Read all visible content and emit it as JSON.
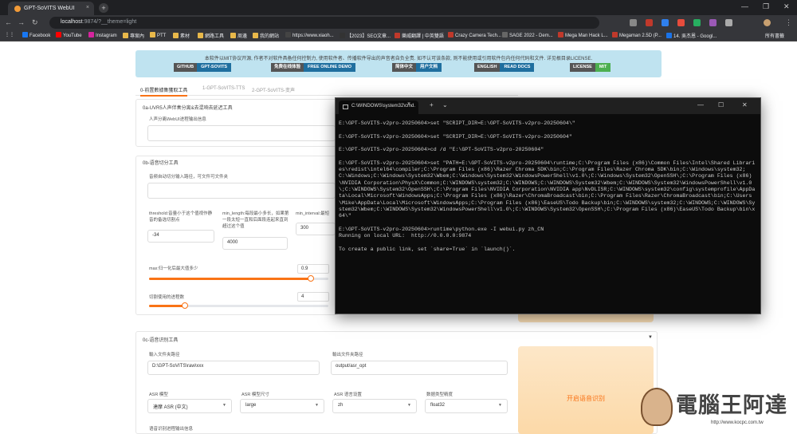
{
  "browser": {
    "tab_title": "GPT-SoVITS WebUI",
    "tab_close": "×",
    "new_tab": "+",
    "url_host": "localhost",
    "url_rest": ":9874/?__theme=light",
    "window_controls": [
      "—",
      "❐",
      "✕"
    ],
    "bookmarks": [
      "Facebook",
      "YouTube",
      "Instagram",
      "專案內",
      "PTT",
      "素材",
      "網路工具",
      "周邊",
      "我的網站",
      "https://www.xiaoh...",
      "【2023】SEO文章...",
      "樂威翻譯 | 中英雙語",
      "Crazy Camera Tech...",
      "SAGE 2022 - Dem...",
      "Mega Man Hack L...",
      "Megaman 2.5D (P...",
      "14. 吳杰恩 - Googl..."
    ],
    "bookmarks_right": "所有書籤",
    "colors": {
      "chrome_dark": "#35363a",
      "accent": "#f97316"
    }
  },
  "banner": {
    "text": "本软件以MIT协议开源, 作者不对软件具备任何控制力, 使用软件者、传播软件导出的声音者自负全责. 如不认可该条款, 则不能使用或引用软件包内任何代码和文件. 详见根目录LICENSE.",
    "badges": [
      {
        "left": "GITHUB",
        "right": "GPT-SOVITS"
      },
      {
        "left": "免费在线体验",
        "right": "FREE ONLINE DEMO"
      },
      {
        "left": "简体中文",
        "right": "用户文档"
      },
      {
        "left": "ENGLISH",
        "right": "READ DOCS"
      },
      {
        "left": "LICENSE",
        "right": "MIT"
      }
    ]
  },
  "tabs": [
    "0-前置數據集獲取工具",
    "1-GPT-SoVITS-TTS",
    "2-GPT-SoVITS-变声"
  ],
  "uvr": {
    "title": "0a-UVR5人声伴奏分离&去混响去延迟工具",
    "field_label": "人声分离WebUI进程输出信息"
  },
  "slicer": {
    "title": "0b-语音切分工具",
    "input_label": "音频自动切分输入路径，可文件可文件夹",
    "threshold_label": "threshold:音量小于这个值视作静音的备选切割点",
    "threshold_value": "-34",
    "minlen_label": "min_length:每段最小多长，如果第一段太短一直和后面段连起来直到超过这个值",
    "minlen_value": "4000",
    "mininterval_label": "min_interval:最短",
    "mininterval_value": "300",
    "max_label": "max:归一化后最大值多少",
    "max_value": "0.9",
    "max_fraction": 0.9,
    "procs_label": "切割使用的进程数",
    "procs_value": "4",
    "procs_fraction": 0.2
  },
  "asr": {
    "title": "0c-语音识别工具",
    "collapse": "▼",
    "input_label": "輸入文件夹路径",
    "input_value": "D:\\GPT-SoVITS\\raw\\xxx",
    "output_label": "輸出文件夹路径",
    "output_value": "output/asr_opt",
    "model_label": "ASR 模型",
    "model_value": "達摩 ASR (中文)",
    "size_label": "ASR 模型尺寸",
    "size_value": "large",
    "lang_label": "ASR 语言设置",
    "lang_value": "zh",
    "precision_label": "数据类型精度",
    "precision_value": "float32",
    "button": "开启语音识别",
    "log_label": "语音识别进程输出信息"
  },
  "terminal": {
    "tab_title": "C:\\WINDOWS\\system32\\cmd.",
    "controls": [
      "×",
      "+",
      "⌄",
      "—",
      "☐",
      "✕"
    ],
    "lines": [
      "E:\\GPT-SoVITS-v2pro-20250604>set \"SCRIPT_DIR=E:\\GPT-SoVITS-v2pro-20250604\\\"",
      "",
      "E:\\GPT-SoVITS-v2pro-20250604>set \"SCRIPT_DIR=E:\\GPT-SoVITS-v2pro-20250604\"",
      "",
      "E:\\GPT-SoVITS-v2pro-20250604>cd /d \"E:\\GPT-SoVITS-v2pro-20250604\"",
      "",
      "E:\\GPT-SoVITS-v2pro-20250604>set \"PATH=E:\\GPT-SoVITS-v2pro-20250604\\runtime;C:\\Program Files (x86)\\Common Files\\Intel\\Shared Libraries\\redist\\intel64\\compiler;C:\\Program Files (x86)\\Razer Chroma SDK\\bin;C:\\Program Files\\Razer Chroma SDK\\bin;C:\\Windows\\system32;C:\\Windows;C:\\Windows\\System32\\Wbem;C:\\Windows\\System32\\WindowsPowerShell\\v1.0\\;C:\\Windows\\System32\\OpenSSH\\;C:\\Program Files (x86)\\NVIDIA Corporation\\PhysX\\Common;C:\\WINDOWS\\system32;C:\\WINDOWS;C:\\WINDOWS\\System32\\Wbem;C:\\WINDOWS\\System32\\WindowsPowerShell\\v1.0\\;C:\\WINDOWS\\System32\\OpenSSH\\;C:\\Program Files\\NVIDIA Corporation\\NVIDIA app\\NvDLISR;C:\\WINDOWS\\system32\\config\\systemprofile\\AppData\\Local\\Microsoft\\WindowsApps;C:\\Program Files (x86)\\Razer\\ChromaBroadcast\\bin;C:\\Program Files\\Razer\\ChromaBroadcast\\bin;C:\\Users\\Mike\\AppData\\Local\\Microsoft\\WindowsApps;C:\\Program Files (x86)\\EaseUS\\Todo Backup\\bin;C:\\WINDOWS\\system32;C:\\WINDOWS;C:\\WINDOWS\\System32\\Wbem;C:\\WINDOWS\\System32\\WindowsPowerShell\\v1.0\\;C:\\WINDOWS\\System32\\OpenSSH\\;C:\\Program Files (x86)\\EaseUS\\Todo Backup\\bin\\x64\\\"",
      "",
      "E:\\GPT-SoVITS-v2pro-20250604>runtime\\python.exe -I webui.py zh_CN",
      "Running on local URL:  http://0.0.0.0:9874",
      "",
      "To create a public link, set `share=True` in `launch()`."
    ]
  },
  "watermark": {
    "text": "電腦王阿達",
    "url": "http://www.kocpc.com.tw"
  }
}
